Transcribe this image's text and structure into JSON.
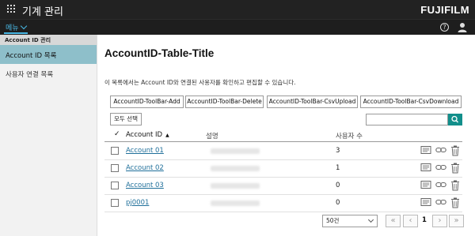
{
  "topbar": {
    "title": "기계 관리",
    "brand_main": "FUJIFILM"
  },
  "menubar": {
    "menu_label": "메뉴",
    "help_glyph": "?"
  },
  "sidebar": {
    "section": "Account ID 관리",
    "items": [
      {
        "label": "Account ID 목록",
        "active": true
      },
      {
        "label": "사용자 연결 목록",
        "active": false
      }
    ]
  },
  "main": {
    "title": "AccountID-Table-Title",
    "description": "이 목록에서는 Account ID와 연결된 사용자를 확인하고 편집할 수 있습니다.",
    "toolbar": {
      "add": "AccountID-ToolBar-Add",
      "delete": "AccountID-ToolBar-Delete",
      "csv_upload": "AccountID-ToolBar-CsvUpload",
      "csv_download": "AccountID-ToolBar-CsvDownload"
    },
    "select_all": "모두 선택",
    "search": {
      "value": "",
      "placeholder": ""
    },
    "table": {
      "header_check": "✓",
      "col_id": "Account ID",
      "sort_glyph": "▲",
      "col_desc": "설명",
      "col_count": "사용자 수",
      "rows": [
        {
          "id": "Account 01",
          "count": "3"
        },
        {
          "id": "Account 02",
          "count": "1"
        },
        {
          "id": "Account 03",
          "count": "0"
        },
        {
          "id": "pj0001",
          "count": "0"
        }
      ]
    },
    "pager": {
      "per_page": "50건",
      "first": "«",
      "prev": "‹",
      "page": "1",
      "next": "›",
      "last": "»"
    }
  }
}
